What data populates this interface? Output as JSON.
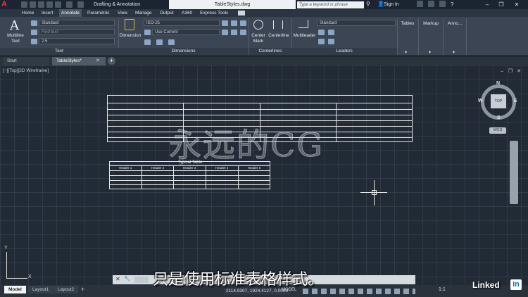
{
  "titlebar": {
    "app_logo": "A",
    "workspace": "Drafting & Annotation",
    "document_title": "TableStyles.dwg",
    "search_placeholder": "Type a keyword or phrase",
    "sign_in": "Sign In",
    "help": "?"
  },
  "ribbon_tabs": [
    "Home",
    "Insert",
    "Annotate",
    "Parametric",
    "View",
    "Manage",
    "Output",
    "A360",
    "Express Tools"
  ],
  "active_tab": "Annotate",
  "ribbon": {
    "text_panel": {
      "big_button": "Multiline Text",
      "style": "Standard",
      "find_placeholder": "Find text",
      "height": "2.5",
      "label": "Text"
    },
    "dimensions_panel": {
      "big_button": "Dimension",
      "style": "ISO-25",
      "layer": "Use Current",
      "label": "Dimensions"
    },
    "centerlines_panel": {
      "center_mark": "Center Mark",
      "centerline": "Centerline",
      "label": "Centerlines"
    },
    "leaders_panel": {
      "big_button": "Multileader",
      "style": "Standard",
      "label": "Leaders"
    },
    "tables_panel": {
      "label": "Tables"
    },
    "markup_panel": {
      "label": "Markup"
    },
    "anno_panel": {
      "label": "Anno..."
    }
  },
  "file_tabs": [
    "Start",
    "TableStyles*"
  ],
  "viewport_label": "[−][Top][2D Wireframe]",
  "viewcube": {
    "top": "TOP",
    "north": "N",
    "south": "S",
    "east": "E",
    "west": "W",
    "wcs": "WCS"
  },
  "table2": {
    "title": "Typical Table",
    "headers": [
      "Header 1",
      "Header 2",
      "Header 3",
      "Header 4",
      "Header 5"
    ]
  },
  "watermark": "永远的CG",
  "command_line": {
    "close": "✕",
    "settings": "🔧"
  },
  "layout_tabs": [
    "Model",
    "Layout1",
    "Layout2"
  ],
  "status": {
    "coords": "2114.9307, 1924.4127, 0.0000",
    "model": "MODEL",
    "scale": "1:1"
  },
  "subtitle": "只是使用标准表格样式。",
  "branding": {
    "linkedin": "Linked",
    "in": "in"
  }
}
